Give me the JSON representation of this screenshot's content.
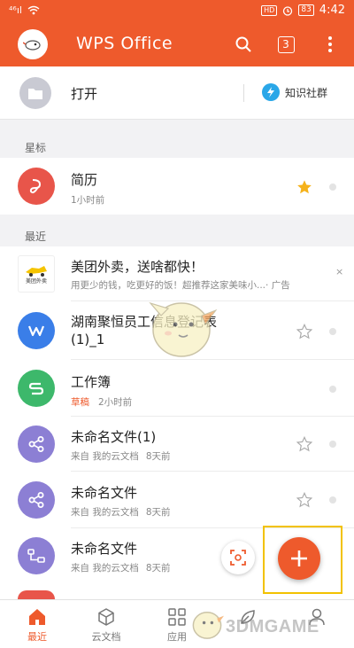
{
  "status_bar": {
    "signal": "⁴⁶ıl",
    "hd": "HD",
    "battery": "83",
    "time": "4:42"
  },
  "app_bar": {
    "title": "WPS Office",
    "tab_count": "3",
    "icons": [
      "avatar-icon",
      "search-icon",
      "tabs-icon",
      "more-icon"
    ],
    "accent_color": "#ee5a2c"
  },
  "open_bar": {
    "open_label": "打开",
    "community_label": "知识社群"
  },
  "sections": {
    "starred_label": "星标",
    "recent_label": "最近"
  },
  "starred_files": [
    {
      "name": "简历",
      "meta": "1小时前",
      "icon": "pdf-icon",
      "color": "#e8554a",
      "starred": true
    }
  ],
  "ad": {
    "logo_text": "美团外卖",
    "title": "美团外卖，送啥都快！",
    "subtitle": "用更少的钱，吃更好的饭！超推荐这家美味小...",
    "ad_tag": "· 广告",
    "close": "×"
  },
  "recent_files": [
    {
      "name": "湖南聚恒员工信息登记表",
      "name_line2": "(1)_1",
      "meta_prefix": "",
      "meta_source": "",
      "meta_time": "",
      "icon": "word-icon",
      "color": "#3a7ee8"
    },
    {
      "name": "工作簿",
      "meta_prefix": "草稿",
      "meta_source": "",
      "meta_time": "2小时前",
      "icon": "sheet-icon",
      "color": "#3db86b"
    },
    {
      "name": "未命名文件(1)",
      "meta_prefix": "",
      "meta_source": "来自 我的云文档",
      "meta_time": "8天前",
      "icon": "share-icon",
      "color": "#8c7fd4"
    },
    {
      "name": "未命名文件",
      "meta_prefix": "",
      "meta_source": "来自 我的云文档",
      "meta_time": "8天前",
      "icon": "share-icon",
      "color": "#8c7fd4"
    },
    {
      "name": "未命名文件",
      "meta_prefix": "",
      "meta_source": "来自 我的云文档",
      "meta_time": "8天前",
      "icon": "mindmap-icon",
      "color": "#8c7fd4"
    }
  ],
  "fab": {
    "icon": "plus-icon"
  },
  "bottom_nav": [
    {
      "label": "最近",
      "icon": "home-icon",
      "active": true
    },
    {
      "label": "云文档",
      "icon": "cube-icon",
      "active": false
    },
    {
      "label": "应用",
      "icon": "grid-icon",
      "active": false
    },
    {
      "label": "",
      "icon": "leaf-icon",
      "active": false
    },
    {
      "label": "",
      "icon": "person-icon",
      "active": false
    }
  ],
  "watermark": "3DMGAME"
}
